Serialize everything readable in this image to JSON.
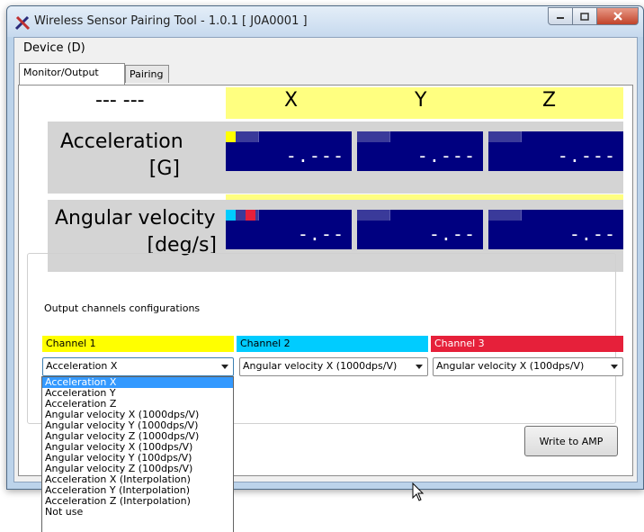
{
  "window": {
    "title": "Wireless Sensor Pairing Tool - 1.0.1 [ J0A0001 ]",
    "controls": {
      "minimize": "minimize-icon",
      "maximize": "maximize-icon",
      "close": "close-icon"
    }
  },
  "menu": {
    "device": "Device (D)"
  },
  "tabs": [
    {
      "label": "Monitor/Output",
      "active": true
    },
    {
      "label": "Pairing",
      "active": false
    }
  ],
  "monitor": {
    "corner_label": "--- ---",
    "axes": [
      "X",
      "Y",
      "Z"
    ],
    "rows": [
      {
        "label_line1": "Acceleration",
        "label_line2": "[G]",
        "values": [
          "-.---",
          "-.---",
          "-.---"
        ]
      },
      {
        "label_line1": "Angular velocity",
        "label_line2": "[deg/s]",
        "values": [
          "-.--",
          "-.--",
          "-.--"
        ]
      }
    ]
  },
  "output": {
    "group_label": "Output channels configurations",
    "channels": [
      {
        "label": "Channel 1",
        "color": "#ffff00",
        "selected": "Acceleration X"
      },
      {
        "label": "Channel 2",
        "color": "#00ccff",
        "selected": "Angular velocity X (1000dps/V)"
      },
      {
        "label": "Channel 3",
        "color": "#e6203a",
        "selected": "Angular velocity X (100dps/V)"
      }
    ],
    "write_button": "Write to AMP"
  },
  "dropdown": {
    "options": [
      "Acceleration X",
      "Acceleration Y",
      "Acceleration Z",
      "Angular velocity X (1000dps/V)",
      "Angular velocity Y (1000dps/V)",
      "Angular velocity Z (1000dps/V)",
      "Angular velocity X (100dps/V)",
      "Angular velocity Y (100dps/V)",
      "Angular velocity Z (100dps/V)",
      "Acceleration X (Interpolation)",
      "Acceleration Y (Interpolation)",
      "Acceleration Z (Interpolation)",
      "Not use"
    ],
    "highlighted": "Acceleration X"
  }
}
